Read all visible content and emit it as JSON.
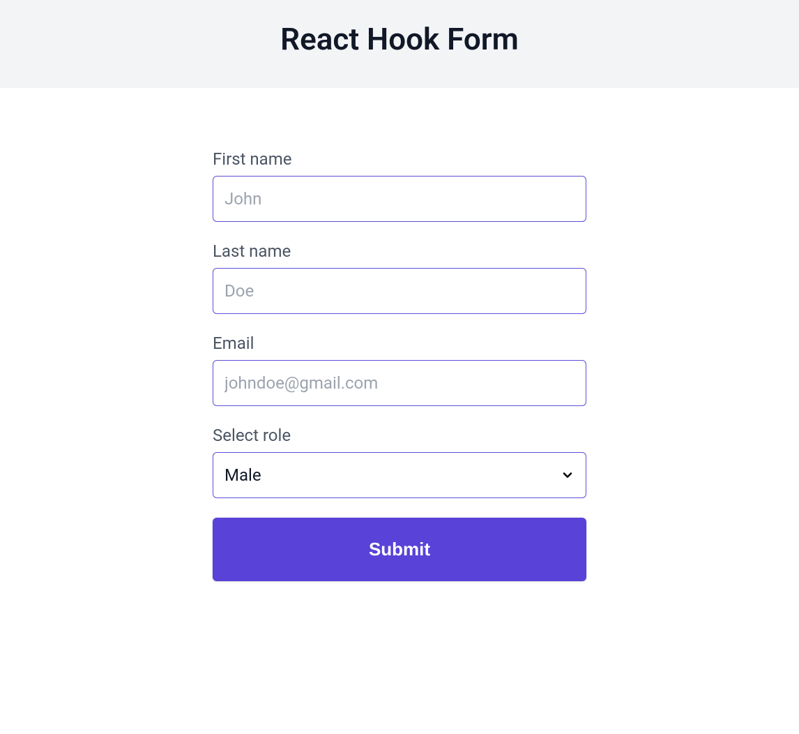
{
  "header": {
    "title": "React Hook Form"
  },
  "form": {
    "first_name": {
      "label": "First name",
      "placeholder": "John",
      "value": ""
    },
    "last_name": {
      "label": "Last name",
      "placeholder": "Doe",
      "value": ""
    },
    "email": {
      "label": "Email",
      "placeholder": "johndoe@gmail.com",
      "value": ""
    },
    "role": {
      "label": "Select role",
      "selected": "Male"
    },
    "submit_label": "Submit"
  }
}
